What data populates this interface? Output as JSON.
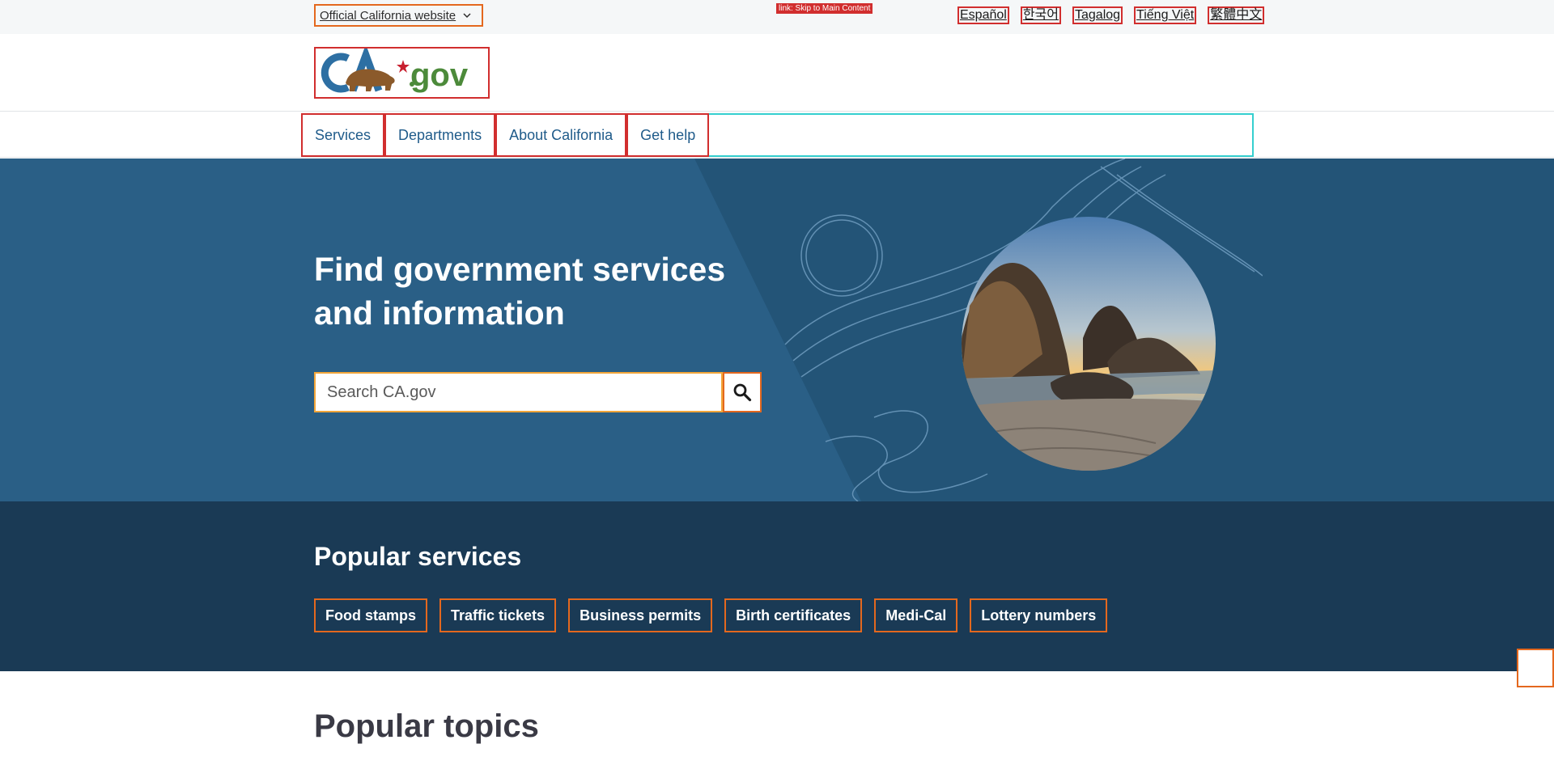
{
  "utility": {
    "official_label": "Official California website",
    "skip_label": "link: Skip to Main Content",
    "languages": [
      "Español",
      "한국어",
      "Tagalog",
      "Tiếng Việt",
      "繁體中文"
    ]
  },
  "branding": {
    "logo_text": "CA.gov"
  },
  "nav": {
    "items": [
      "Services",
      "Departments",
      "About California",
      "Get help"
    ]
  },
  "hero": {
    "title": "Find government services and information",
    "search_placeholder": "Search CA.gov",
    "submit_icon": "search-icon",
    "image": "beach-rocks-sunset-photo"
  },
  "services": {
    "title": "Popular services",
    "items": [
      "Food stamps",
      "Traffic tickets",
      "Business permits",
      "Birth certificates",
      "Medi-Cal",
      "Lottery numbers"
    ]
  },
  "topics": {
    "title": "Popular topics"
  },
  "colors": {
    "hero_bg": "#235477",
    "services_bg": "#1a3a55",
    "nav_text": "#1f5b8a",
    "accent_orange": "#e4681e",
    "accent_red": "#d12e2e"
  }
}
